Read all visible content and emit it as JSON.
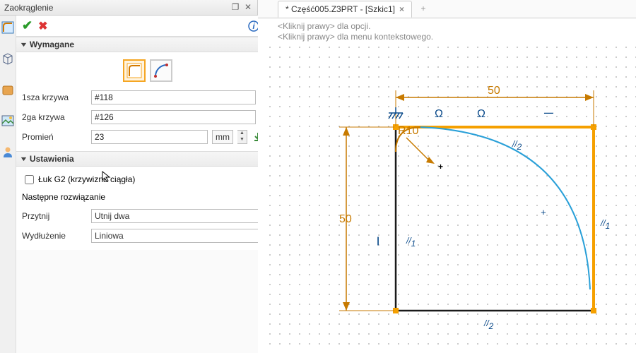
{
  "panel": {
    "title": "Zaokrąglenie",
    "sections": {
      "required_title": "Wymagane",
      "settings_title": "Ustawienia"
    },
    "fields": {
      "curve1_label": "1sza krzywa",
      "curve1_value": "#118",
      "curve2_label": "2ga krzywa",
      "curve2_value": "#126",
      "radius_label": "Promień",
      "radius_value": "23",
      "radius_unit": "mm"
    },
    "settings": {
      "g2_label": "Łuk G2 (krzywizna ciągła)",
      "g2_checked": false,
      "next_solution_label": "Następne rozwiązanie",
      "trim_label": "Przytnij",
      "trim_value": "Utnij dwa",
      "extend_label": "Wydłużenie",
      "extend_value": "Liniowa"
    }
  },
  "tab": {
    "label": "* Część005.Z3PRT - [Szkic1]"
  },
  "hints": {
    "line1": "<Kliknij prawy> dla opcji.",
    "line2": "<Kliknij prawy> dla menu kontekstowego."
  },
  "sketch": {
    "dim_h": "50",
    "dim_v": "50",
    "radius_label": "R10",
    "par1": "//",
    "par2": "//",
    "par3": "//",
    "par4": "//",
    "sub1": "1",
    "sub2": "2",
    "vert": "|",
    "horiz": "—"
  },
  "colors": {
    "dim": "#c77a00",
    "existing": "#1a1a1a",
    "selected": "#f5a000",
    "preview": "#2aa0d8",
    "constraint": "#0a4a8a"
  }
}
